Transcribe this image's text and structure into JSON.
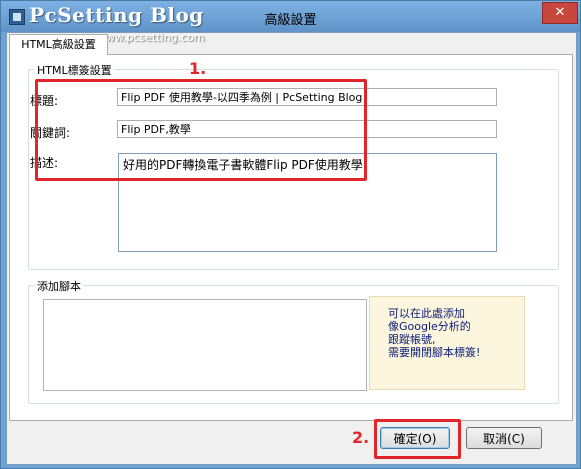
{
  "window": {
    "title": "高級設置",
    "close_glyph": "✕",
    "watermark": "PcSetting Blog",
    "watermark_url": "www.pcsetting.com"
  },
  "tabs": [
    {
      "label": "HTML高級設置"
    }
  ],
  "html_group": {
    "label": "HTML標簽設置",
    "title_label": "標題:",
    "title_value": "Flip PDF 使用教學-以四季為例 | PcSetting Blog",
    "keywords_label": "關鍵詞:",
    "keywords_value": "Flip PDF,教學",
    "description_label": "描述:",
    "description_value": "好用的PDF轉換電子書軟體Flip PDF使用教學"
  },
  "script_group": {
    "label": "添加腳本",
    "hint_lines": [
      "可以在此處添加",
      "像Google分析的",
      "跟蹤帳號,",
      "需要開閉腳本標簽!"
    ]
  },
  "annotations": {
    "step1": "1.",
    "step2": "2.",
    "color": "#e1262b"
  },
  "buttons": {
    "ok": "確定(O)",
    "cancel": "取消(C)"
  },
  "colors": {
    "title_bar": "#6fa3d6",
    "close_button": "#c7463d",
    "hint_bg": "#fbf6dd",
    "hint_text": "#0b1b78"
  }
}
